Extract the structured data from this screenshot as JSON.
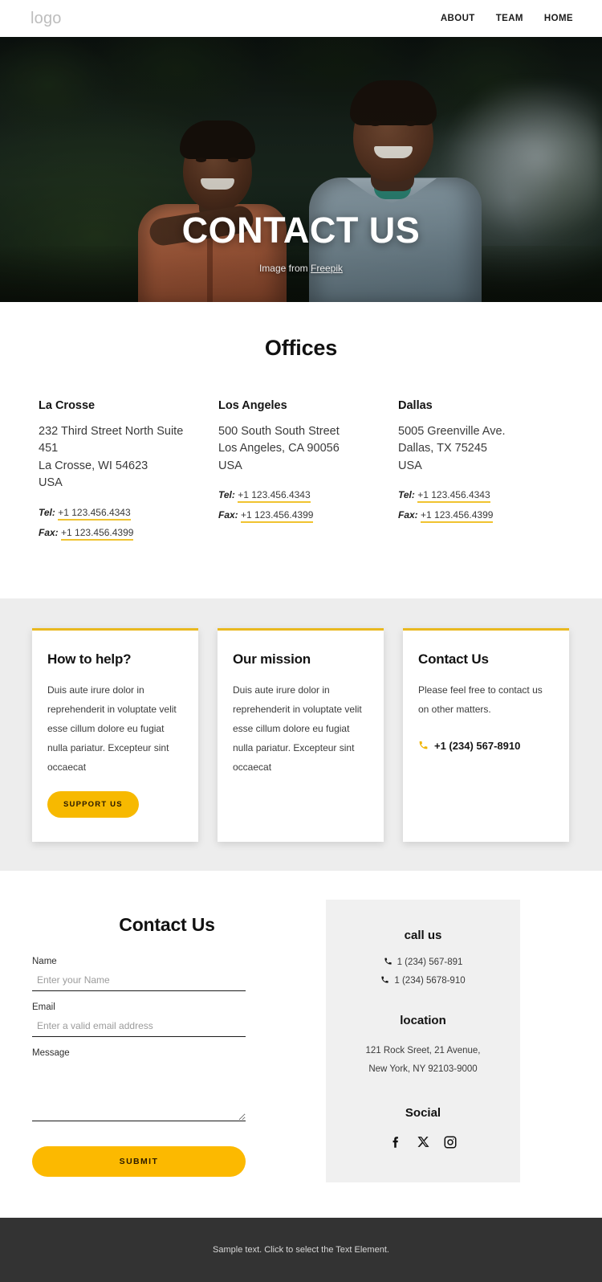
{
  "header": {
    "logo": "logo",
    "nav": [
      {
        "label": "ABOUT"
      },
      {
        "label": "TEAM"
      },
      {
        "label": "HOME"
      }
    ]
  },
  "hero": {
    "title": "CONTACT US",
    "credit_prefix": "Image from ",
    "credit_link": "Freepik"
  },
  "offices": {
    "title": "Offices",
    "items": [
      {
        "name": "La Crosse",
        "address": "232 Third Street North Suite 451\nLa Crosse, WI 54623\nUSA",
        "tel_label": "Tel:",
        "tel": "+1 123.456.4343",
        "fax_label": "Fax:",
        "fax": "+1 123.456.4399"
      },
      {
        "name": "Los Angeles",
        "address": "500 South South Street\nLos Angeles, CA 90056\nUSA",
        "tel_label": "Tel:",
        "tel": "+1 123.456.4343",
        "fax_label": "Fax:",
        "fax": "+1 123.456.4399"
      },
      {
        "name": "Dallas",
        "address": "5005 Greenville Ave.\nDallas, TX 75245\nUSA",
        "tel_label": "Tel:",
        "tel": "+1 123.456.4343",
        "fax_label": "Fax:",
        "fax": "+1 123.456.4399"
      }
    ]
  },
  "cards": [
    {
      "title": "How to help?",
      "text": "Duis aute irure dolor in reprehenderit in voluptate velit esse cillum dolore eu fugiat nulla pariatur. Excepteur sint occaecat",
      "button": "SUPPORT US"
    },
    {
      "title": "Our mission",
      "text": "Duis aute irure dolor in reprehenderit in voluptate velit esse cillum dolore eu fugiat nulla pariatur. Excepteur sint occaecat"
    },
    {
      "title": "Contact Us",
      "text": "Please feel free to contact us on other matters.",
      "phone": "+1 (234) 567-8910",
      "phone_icon": "phone-icon"
    }
  ],
  "contact": {
    "form_title": "Contact Us",
    "fields": {
      "name_label": "Name",
      "name_placeholder": "Enter your Name",
      "name_value": "",
      "email_label": "Email",
      "email_placeholder": "Enter a valid email address",
      "email_value": "",
      "message_label": "Message",
      "message_placeholder": "",
      "message_value": ""
    },
    "submit": "SUBMIT",
    "aside": {
      "call_title": "call us",
      "phones": [
        "1 (234) 567-891",
        "1 (234) 5678-910"
      ],
      "location_title": "location",
      "address_line1": "121 Rock Sreet, 21 Avenue,",
      "address_line2": "New York, NY 92103-9000",
      "social_title": "Social",
      "social_icons": [
        "facebook-icon",
        "x-twitter-icon",
        "instagram-icon"
      ]
    }
  },
  "footer": {
    "text": "Sample text. Click to select the Text Element."
  },
  "colors": {
    "accent": "#f7b900",
    "accent_border": "#e9b920",
    "underline": "#f0c330",
    "footer_bg": "#333333",
    "section_gray": "#ededed",
    "aside_gray": "#f0f0f0"
  }
}
